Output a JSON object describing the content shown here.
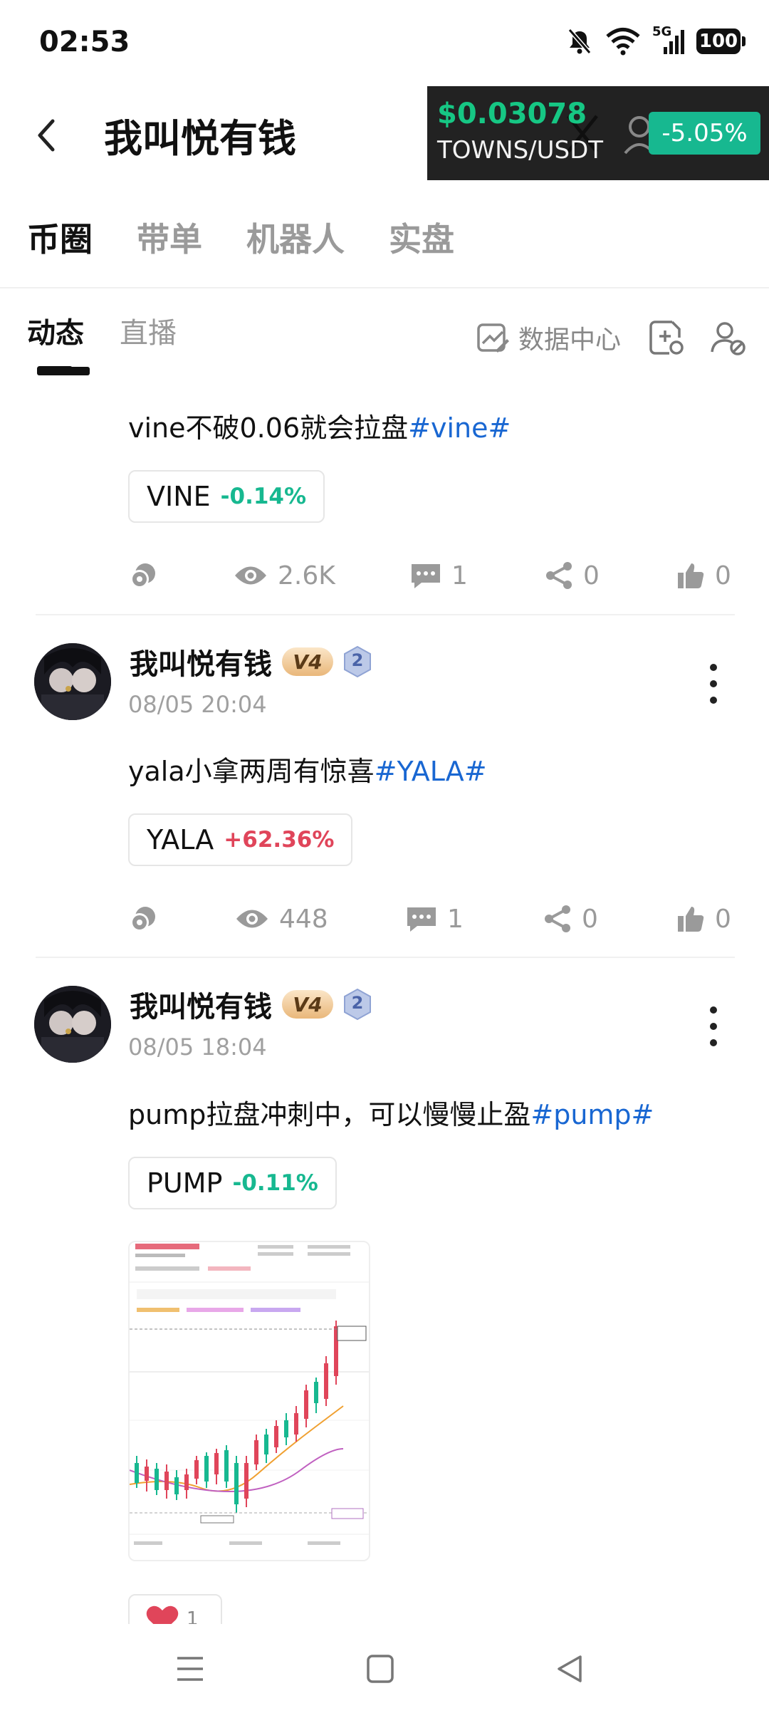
{
  "status_bar": {
    "time": "02:53",
    "network": "5G",
    "battery": "100"
  },
  "header": {
    "title": "我叫悦有钱"
  },
  "ticker": {
    "price": "$0.03078",
    "pair": "TOWNS/USDT",
    "change": "-5.05%"
  },
  "category_tabs": [
    "币圈",
    "带单",
    "机器人",
    "实盘"
  ],
  "sub_tabs": [
    "动态",
    "直播"
  ],
  "tools": {
    "data_center_label": "数据中心"
  },
  "posts": [
    {
      "text": "vine不破0.06就会拉盘",
      "hashtag": "#vine#",
      "coin": {
        "symbol": "VINE",
        "change": "-0.14%"
      },
      "stats": {
        "views": "2.6K",
        "comments": "1",
        "shares": "0",
        "likes": "0"
      }
    },
    {
      "author": "我叫悦有钱",
      "vip": "V4",
      "level": "2",
      "time": "08/05 20:04",
      "text": "yala小拿两周有惊喜",
      "hashtag": "#YALA#",
      "coin": {
        "symbol": "YALA",
        "change": "+62.36%"
      },
      "stats": {
        "views": "448",
        "comments": "1",
        "shares": "0",
        "likes": "0"
      }
    },
    {
      "author": "我叫悦有钱",
      "vip": "V4",
      "level": "2",
      "time": "08/05 18:04",
      "text": "pump拉盘冲刺中，可以慢慢止盈",
      "hashtag": "#pump#",
      "coin": {
        "symbol": "PUMP",
        "change": "-0.11%"
      },
      "reactions": {
        "heart": "1"
      }
    }
  ],
  "colors": {
    "accent_blue": "#1967d2",
    "down_green": "#17b890",
    "up_red": "#e0455a",
    "ticker_bg": "#222222"
  }
}
